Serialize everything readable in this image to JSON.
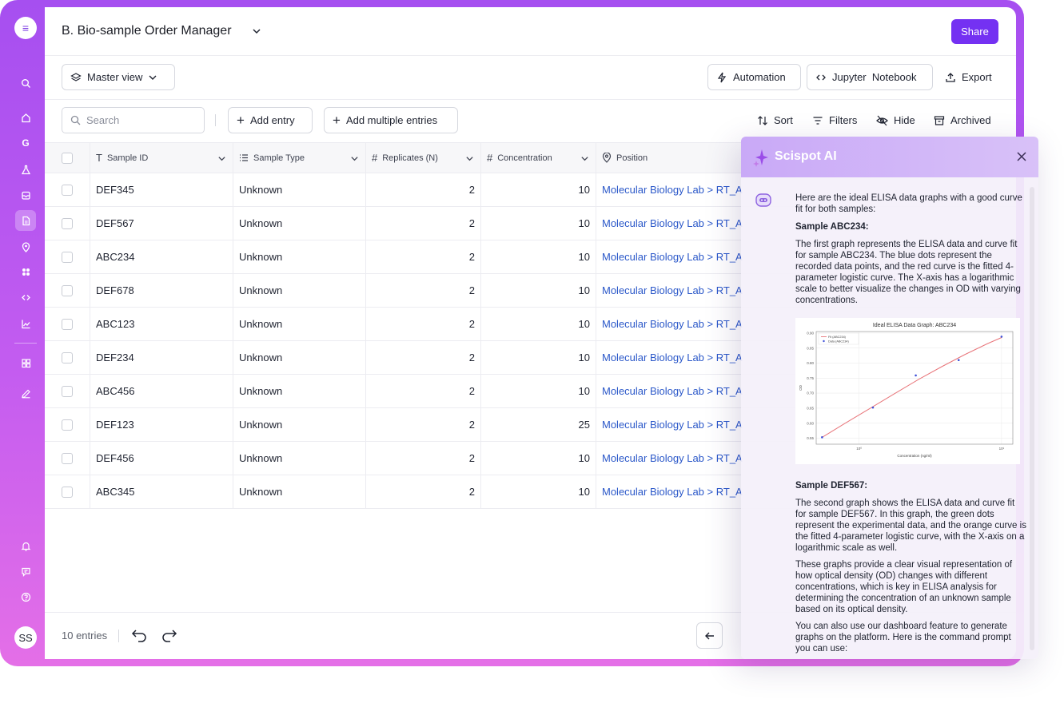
{
  "app": {
    "title": "B. Bio-sample Order Manager",
    "share_label": "Share",
    "accent": "#7431f2",
    "sidebar_gradient": [
      "#a64ff0",
      "#e46fe7"
    ]
  },
  "sidebar": {
    "top_icon": "menu-icon",
    "items": [
      {
        "icon": "search-icon"
      },
      {
        "icon": "home-icon"
      },
      {
        "icon": "g-letter-icon",
        "glyph": "G"
      },
      {
        "icon": "flask-icon"
      },
      {
        "icon": "inbox-icon"
      },
      {
        "icon": "document-icon",
        "active": true
      },
      {
        "icon": "location-pin-icon"
      },
      {
        "icon": "apps-icon"
      },
      {
        "icon": "code-icon"
      },
      {
        "icon": "chart-icon"
      },
      {
        "icon": "grid-icon"
      },
      {
        "icon": "pen-icon"
      }
    ],
    "bottom_items": [
      {
        "icon": "bell-icon"
      },
      {
        "icon": "chat-icon"
      },
      {
        "icon": "help-icon"
      }
    ],
    "avatar_initials": "SS"
  },
  "viewbar": {
    "view_label": "Master view",
    "automation_label": "Automation",
    "jupyter_label": "Jupyter  Notebook",
    "export_label": "Export"
  },
  "toolbar": {
    "search_placeholder": "Search",
    "add_entry_label": "Add entry",
    "add_multiple_label": "Add multiple entries",
    "sort_label": "Sort",
    "filters_label": "Filters",
    "hide_label": "Hide",
    "archived_label": "Archived"
  },
  "table": {
    "columns": [
      {
        "label": "Sample ID",
        "type_icon": "text-type-icon"
      },
      {
        "label": "Sample Type",
        "type_icon": "list-type-icon"
      },
      {
        "label": "Replicates (N)",
        "type_icon": "number-type-icon"
      },
      {
        "label": "Concentration",
        "type_icon": "number-type-icon"
      },
      {
        "label": "Position",
        "type_icon": "location-type-icon"
      }
    ],
    "rows": [
      {
        "id": "DEF345",
        "type": "Unknown",
        "replicates": "2",
        "concentration": "10",
        "position": "Molecular Biology Lab > RT_A"
      },
      {
        "id": "DEF567",
        "type": "Unknown",
        "replicates": "2",
        "concentration": "10",
        "position": "Molecular Biology Lab > RT_A"
      },
      {
        "id": "ABC234",
        "type": "Unknown",
        "replicates": "2",
        "concentration": "10",
        "position": "Molecular Biology Lab > RT_A"
      },
      {
        "id": "DEF678",
        "type": "Unknown",
        "replicates": "2",
        "concentration": "10",
        "position": "Molecular Biology Lab > RT_A"
      },
      {
        "id": "ABC123",
        "type": "Unknown",
        "replicates": "2",
        "concentration": "10",
        "position": "Molecular Biology Lab > RT_A"
      },
      {
        "id": "DEF234",
        "type": "Unknown",
        "replicates": "2",
        "concentration": "10",
        "position": "Molecular Biology Lab > RT_A"
      },
      {
        "id": "ABC456",
        "type": "Unknown",
        "replicates": "2",
        "concentration": "10",
        "position": "Molecular Biology Lab > RT_A"
      },
      {
        "id": "DEF123",
        "type": "Unknown",
        "replicates": "2",
        "concentration": "25",
        "position": "Molecular Biology Lab > RT_A"
      },
      {
        "id": "DEF456",
        "type": "Unknown",
        "replicates": "2",
        "concentration": "10",
        "position": "Molecular Biology Lab > RT_A"
      },
      {
        "id": "ABC345",
        "type": "Unknown",
        "replicates": "2",
        "concentration": "10",
        "position": "Molecular Biology Lab > RT_A"
      }
    ]
  },
  "footer": {
    "entries_label": "10 entries"
  },
  "ai_panel": {
    "title": "Scispot AI",
    "intro": "Here are the ideal ELISA data graphs with a good curve fit for both samples:",
    "section1_title": "Sample ABC234:",
    "section1_text": "The first graph represents the ELISA data and curve fit for sample ABC234. The blue dots represent the recorded data points, and the red curve is the fitted 4-parameter logistic curve. The X-axis has a logarithmic scale to better visualize the changes in OD with varying concentrations.",
    "section2_title": "Sample DEF567:",
    "section2_text": "The second graph shows the ELISA data and curve fit for sample DEF567. In this graph, the green dots represent the experimental data, and the orange curve is the fitted 4-parameter logistic curve, with the X-axis on a logarithmic scale as well.",
    "para3": "These graphs provide a clear visual representation of how optical density (OD) changes with different concentrations, which is key in ELISA analysis for determining the concentration of an unknown sample based on its optical density.",
    "para4": "You can also use our dashboard feature to generate graphs on the platform. Here is the command prompt you can use:"
  },
  "chart_data": {
    "type": "line",
    "title": "Ideal ELISA Data Graph: ABC234",
    "xlabel": "Concentration (ng/ml)",
    "ylabel": "OD",
    "x_scale": "log",
    "xlim": [
      0.5,
      12
    ],
    "ylim": [
      0.53,
      0.905
    ],
    "y_ticks": [
      "0.55",
      "0.60",
      "0.65",
      "0.70",
      "0.75",
      "0.80",
      "0.85",
      "0.90"
    ],
    "x_ticks": [
      "10⁰",
      "10¹"
    ],
    "grid": true,
    "legend_position": "top-left",
    "series": [
      {
        "name": "Fit (ABC234)",
        "kind": "line",
        "color": "#e8757a",
        "x": [
          0.55,
          0.8,
          1.2,
          1.8,
          2.6,
          3.8,
          5.5,
          8.0,
          10.0
        ],
        "y": [
          0.553,
          0.6,
          0.65,
          0.7,
          0.745,
          0.788,
          0.828,
          0.865,
          0.885
        ]
      },
      {
        "name": "Data (ABC234)",
        "kind": "scatter",
        "color": "#3f51d8",
        "x": [
          0.55,
          1.25,
          2.5,
          5.0,
          10.0
        ],
        "y": [
          0.553,
          0.652,
          0.759,
          0.81,
          0.888
        ]
      }
    ]
  }
}
